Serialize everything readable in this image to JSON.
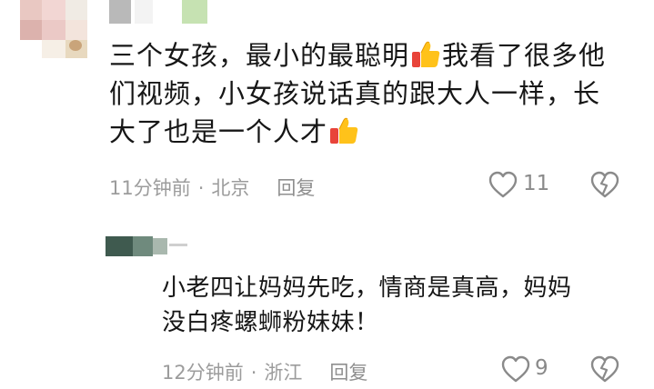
{
  "comment": {
    "line1_a": "三个女孩，最小的最聪明",
    "line1_b": "我看了很多他",
    "line2": "们视频，小女孩说话真的跟大人一样，长",
    "line3": "大了也是一个人才",
    "emoji": "thumbs-up-icon",
    "time": "11分钟前",
    "separator": "·",
    "location": "北京",
    "reply_label": "回复",
    "like_count": "11"
  },
  "reply": {
    "line1": "小老四让妈妈先吃，情商是真高，妈妈",
    "line2": "没白疼螺蛳粉妹妹！",
    "time": "12分钟前",
    "separator": "·",
    "location": "浙江",
    "reply_label": "回复",
    "like_count": "9"
  },
  "colors": {
    "text": "#161616",
    "meta": "#9c9c9c",
    "icon": "#8a8a8a",
    "thumb_red": "#e8443a",
    "thumb_yellow": "#ffc21a"
  }
}
